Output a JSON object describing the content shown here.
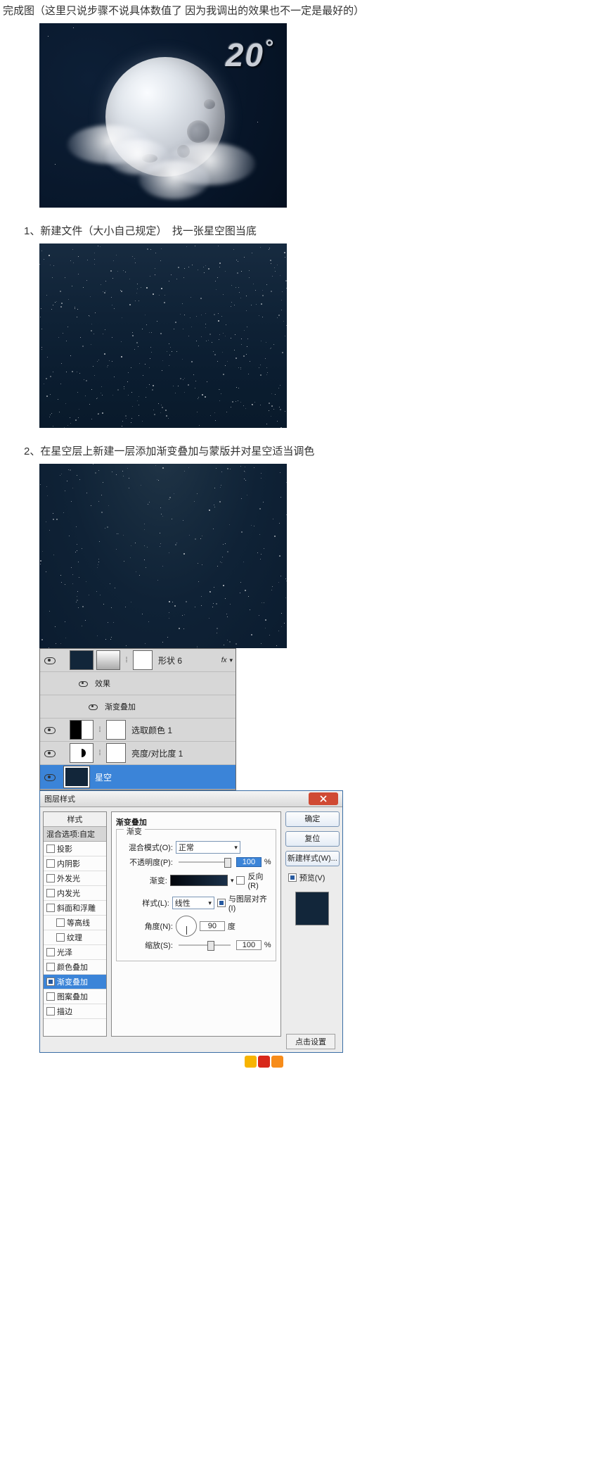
{
  "intro": "完成图（这里只说步骤不说具体数值了 因为我调出的效果也不一定是最好的）",
  "weather": {
    "temp": "20",
    "deg": "°"
  },
  "step1": "1、新建文件（大小自己规定）　找一张星空图当底",
  "step2": "2、在星空层上新建一层添加渐变叠加与蒙版并对星空适当调色",
  "layers": {
    "shape": "形状 6",
    "fx_label": "fx",
    "effects": "效果",
    "grad_overlay_sub": "渐变叠加",
    "select_color": "选取颜色 1",
    "bright_contrast": "亮度/对比度 1",
    "starry_sky": "星空"
  },
  "ls": {
    "title": "图层样式",
    "left_styles": "样式",
    "left_blend": "混合选项:自定",
    "items": {
      "drop_shadow": "投影",
      "inner_shadow": "内阴影",
      "outer_glow": "外发光",
      "inner_glow": "内发光",
      "bevel": "斜面和浮雕",
      "contour": "等高线",
      "texture": "纹理",
      "satin": "光泽",
      "color_overlay": "颜色叠加",
      "gradient_overlay": "渐变叠加",
      "pattern_overlay": "图案叠加",
      "stroke": "描边"
    },
    "section_title": "渐变叠加",
    "subsection_title": "渐变",
    "blend_mode_label": "混合模式(O):",
    "blend_mode_value": "正常",
    "opacity_label": "不透明度(P):",
    "opacity_value": "100",
    "percent": "%",
    "gradient_label": "渐变:",
    "reverse": "反向(R)",
    "style_label": "样式(L):",
    "style_value": "线性",
    "align_layer": "与图层对齐(I)",
    "angle_label": "角度(N):",
    "angle_value": "90",
    "angle_unit": "度",
    "scale_label": "缩放(S):",
    "scale_value": "100",
    "btn_ok": "确定",
    "btn_reset": "复位",
    "btn_newstyle": "新建样式(W)...",
    "preview_label": "预览(V)",
    "click_set": "点击设置"
  }
}
